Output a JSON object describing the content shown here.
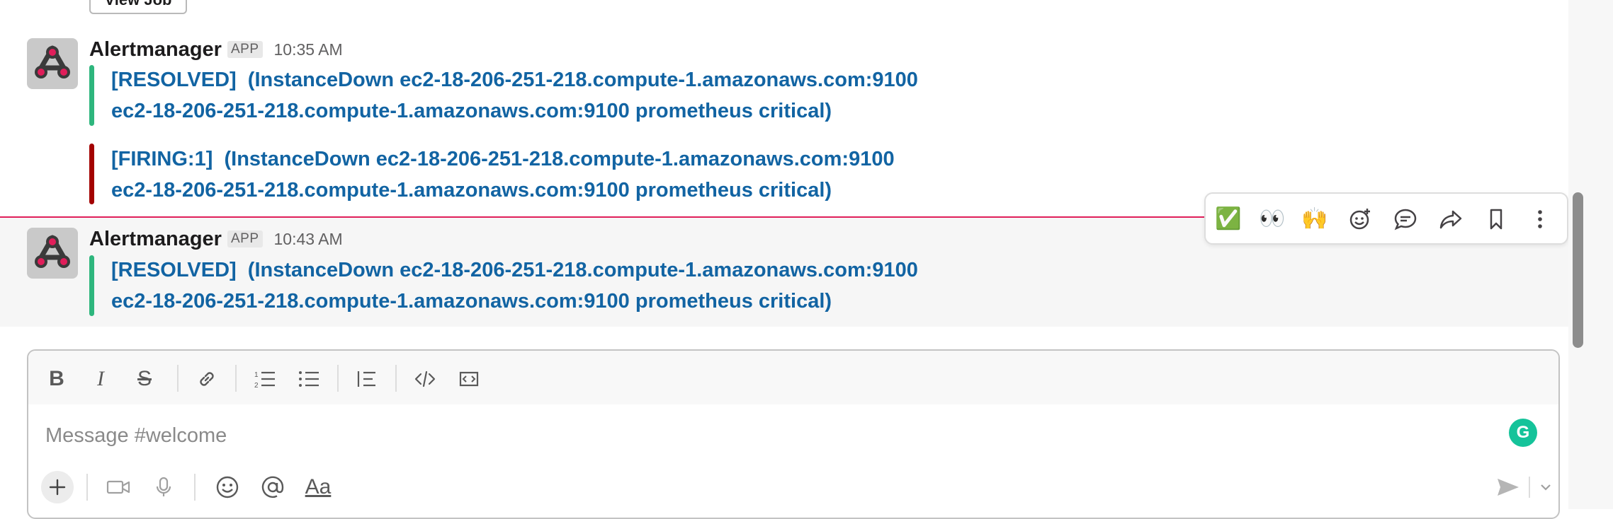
{
  "top": {
    "view_job_label": "View Job"
  },
  "messages": [
    {
      "sender": "Alertmanager",
      "badge": "APP",
      "time": "10:35 AM",
      "attachments": [
        {
          "status": "resolved",
          "color": "#2eb67d",
          "line1": "[RESOLVED]  (InstanceDown ec2-18-206-251-218.compute-1.amazonaws.com:9100",
          "line2": "ec2-18-206-251-218.compute-1.amazonaws.com:9100 prometheus critical)"
        },
        {
          "status": "firing",
          "color": "#a30200",
          "line1": "[FIRING:1]  (InstanceDown ec2-18-206-251-218.compute-1.amazonaws.com:9100",
          "line2": "ec2-18-206-251-218.compute-1.amazonaws.com:9100 prometheus critical)"
        }
      ]
    },
    {
      "sender": "Alertmanager",
      "badge": "APP",
      "time": "10:43 AM",
      "attachments": [
        {
          "status": "resolved",
          "color": "#2eb67d",
          "line1": "[RESOLVED]  (InstanceDown ec2-18-206-251-218.compute-1.amazonaws.com:9100",
          "line2": "ec2-18-206-251-218.compute-1.amazonaws.com:9100 prometheus critical)"
        }
      ]
    }
  ],
  "hover_actions": {
    "icons": [
      "white-check-mark-emoji",
      "eyes-emoji",
      "raised-hands-emoji",
      "add-reaction-icon",
      "reply-in-thread-icon",
      "share-icon",
      "bookmark-icon",
      "more-actions-icon"
    ],
    "check": "✅",
    "eyes": "👀",
    "hands": "🙌"
  },
  "composer": {
    "placeholder": "Message #welcome",
    "format_icons": [
      "bold-icon",
      "italic-icon",
      "strikethrough-icon",
      "link-icon",
      "ordered-list-icon",
      "bulleted-list-icon",
      "blockquote-icon",
      "code-icon",
      "code-block-icon"
    ],
    "bold": "B",
    "italic": "I",
    "strike": "S",
    "aa_label": "Aa",
    "grammarly_label": "G",
    "bottom_icons": [
      "plus-icon",
      "video-icon",
      "microphone-icon",
      "emoji-icon",
      "mention-icon",
      "formatting-toggle-icon",
      "send-icon",
      "send-options-chevron-icon"
    ]
  },
  "colors": {
    "link": "#1264a3",
    "resolved": "#2eb67d",
    "firing": "#a30200",
    "new_divider": "#e01e5a",
    "grammarly": "#15c39a"
  }
}
